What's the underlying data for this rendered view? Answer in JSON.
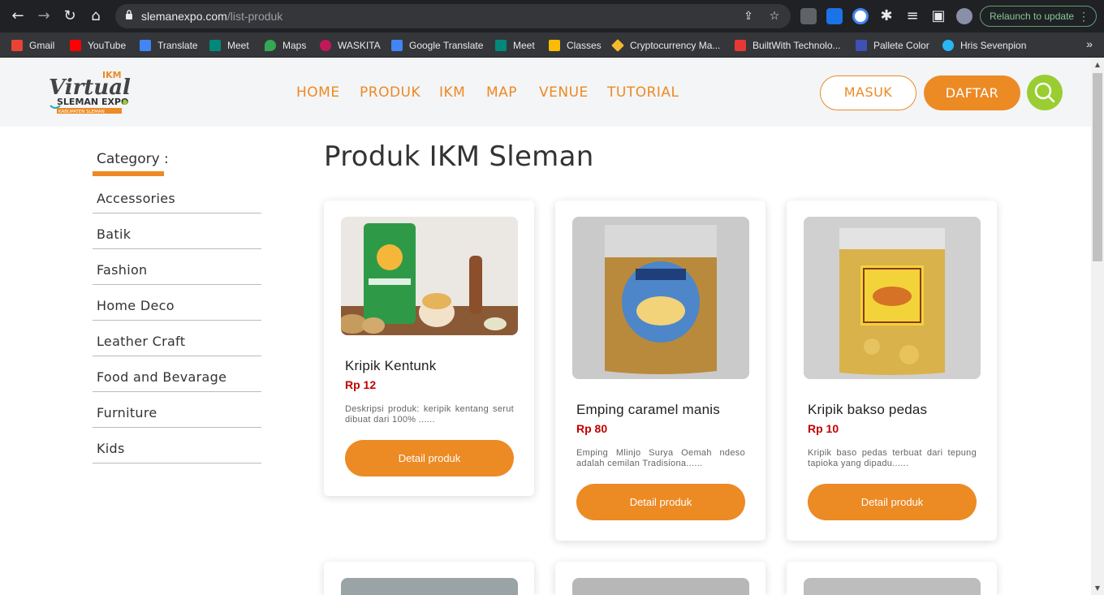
{
  "browser": {
    "url_host": "slemanexpo.com",
    "url_path": "/list-produk",
    "relaunch_label": "Relaunch to update",
    "bookmarks": [
      {
        "label": "Gmail",
        "icon": "gmail-icon",
        "color": "#ea4335"
      },
      {
        "label": "YouTube",
        "icon": "youtube-icon",
        "color": "#ff0000"
      },
      {
        "label": "Translate",
        "icon": "translate-icon",
        "color": "#4285f4"
      },
      {
        "label": "Meet",
        "icon": "meet-icon",
        "color": "#00897b"
      },
      {
        "label": "Maps",
        "icon": "maps-icon",
        "color": "#34a853"
      },
      {
        "label": "WASKITA",
        "icon": "waskita-icon",
        "color": "#c2185b"
      },
      {
        "label": "Google Translate",
        "icon": "google-translate-icon",
        "color": "#4285f4"
      },
      {
        "label": "Meet",
        "icon": "meet-icon",
        "color": "#00897b"
      },
      {
        "label": "Classes",
        "icon": "classes-icon",
        "color": "#fbbc04"
      },
      {
        "label": "Cryptocurrency Ma...",
        "icon": "binance-icon",
        "color": "#f3ba2f"
      },
      {
        "label": "BuiltWith Technolo...",
        "icon": "builtwith-icon",
        "color": "#e53935"
      },
      {
        "label": "Pallete Color",
        "icon": "pallete-icon",
        "color": "#3f51b5"
      },
      {
        "label": "Hris Sevenpion",
        "icon": "hris-icon",
        "color": "#29b6f6"
      }
    ]
  },
  "site": {
    "logo_text": {
      "top": "IKM",
      "main": "Virtual",
      "sub": "SLEMAN EXPO",
      "tag": "KABUPATEN SLEMAN"
    },
    "nav": [
      "HOME",
      "PRODUK",
      "IKM",
      "MAP",
      "VENUE",
      "TUTORIAL"
    ],
    "login_label": "MASUK",
    "register_label": "DAFTAR",
    "accent": "#ec8a24",
    "search_color": "#9acd32"
  },
  "sidebar": {
    "title": "Category :",
    "categories": [
      "Accessories",
      "Batik",
      "Fashion",
      "Home Deco",
      "Leather Craft",
      "Food and Bevarage",
      "Furniture",
      "Kids"
    ]
  },
  "main": {
    "title": "Produk IKM Sleman",
    "products": [
      {
        "name": "Kripik Kentunk",
        "price": "Rp 12",
        "desc": "Deskripsi produk: keripik kentang serut dibuat dari 100% ......",
        "button": "Detail produk",
        "image": "kentunk-photo"
      },
      {
        "name": "Emping caramel manis",
        "price": "Rp 80",
        "desc": "Emping Mlinjo Surya Oemah ndeso adalah cemilan Tradisiona......",
        "button": "Detail produk",
        "image": "emping-photo"
      },
      {
        "name": "Kripik bakso pedas",
        "price": "Rp 10",
        "desc": "Kripik baso pedas terbuat dari tepung tapioka yang dipadu......",
        "button": "Detail produk",
        "image": "kripik-bakso-photo"
      }
    ]
  }
}
